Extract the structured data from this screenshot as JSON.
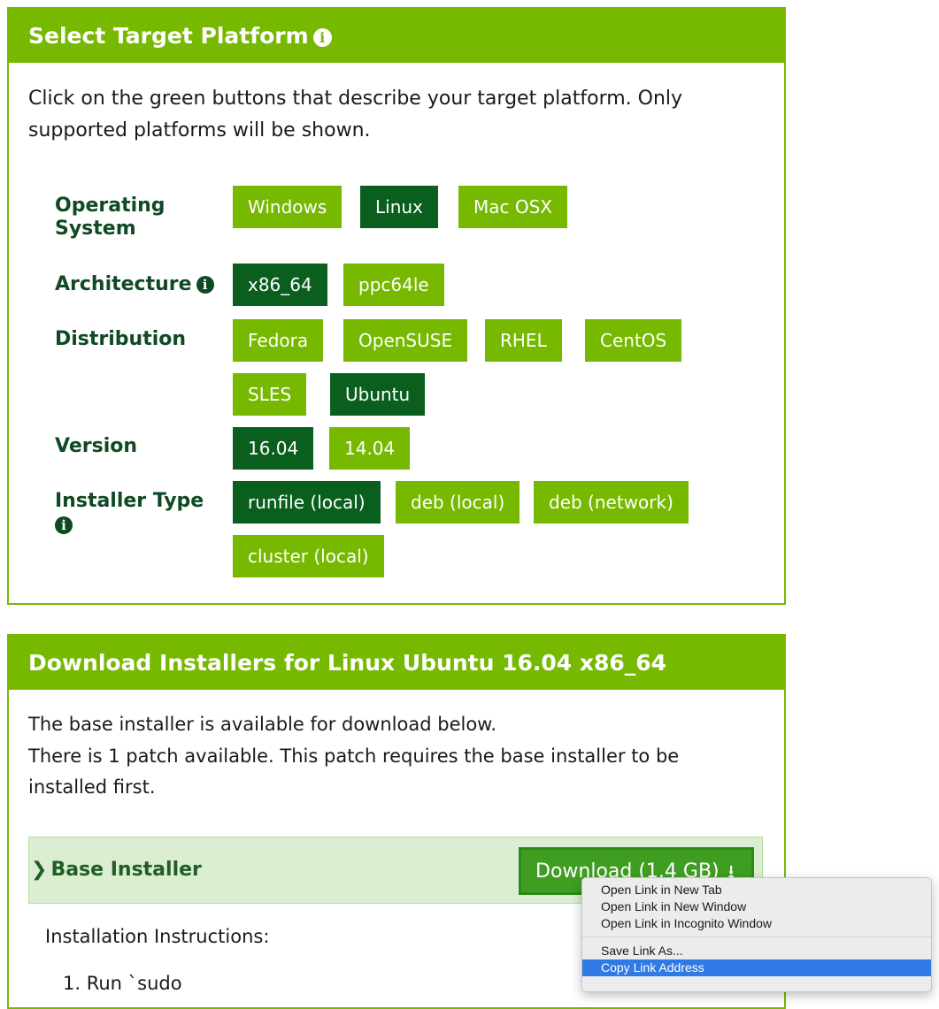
{
  "select_panel": {
    "title": "Select Target Platform",
    "info_icon": "info-icon",
    "intro": "Click on the green buttons that describe your target platform. Only supported platforms will be shown.",
    "rows": {
      "os": {
        "label": "Operating System",
        "options": [
          "Windows",
          "Linux",
          "Mac OSX"
        ],
        "selected": "Linux"
      },
      "arch": {
        "label": "Architecture",
        "options": [
          "x86_64",
          "ppc64le"
        ],
        "selected": "x86_64"
      },
      "distro": {
        "label": "Distribution",
        "options": [
          "Fedora",
          "OpenSUSE",
          "RHEL",
          "CentOS",
          "SLES",
          "Ubuntu"
        ],
        "selected": "Ubuntu"
      },
      "version": {
        "label": "Version",
        "options": [
          "16.04",
          "14.04"
        ],
        "selected": "16.04"
      },
      "installer": {
        "label": "Installer Type",
        "options": [
          "runfile (local)",
          "deb (local)",
          "deb (network)",
          "cluster (local)"
        ],
        "selected": "runfile (local)"
      }
    }
  },
  "download_panel": {
    "title": "Download Installers for Linux Ubuntu 16.04 x86_64",
    "line1": "The base installer is available for download below.",
    "line2": "There is 1 patch available. This patch requires the base installer to be",
    "line3": "installed first.",
    "base_installer": {
      "title": "Base Installer",
      "chevron_icon": "chevron-right-icon",
      "download_label": "Download (1.4 GB)",
      "download_icon": "download-icon"
    },
    "instructions_label": "Installation Instructions:",
    "step1_partial": "1. Run `sudo"
  },
  "context_menu": {
    "items": {
      "open_new_tab": "Open Link in New Tab",
      "open_new_window": "Open Link in New Window",
      "open_incognito": "Open Link in Incognito Window",
      "save_link": "Save Link As...",
      "copy_link": "Copy Link Address"
    },
    "highlighted": "Copy Link Address",
    "highlight_color": "#2f7ae5"
  },
  "colors": {
    "nvidia_green": "#76b900",
    "selected_green": "#0a5e1e",
    "label_green": "#0f4a24"
  }
}
